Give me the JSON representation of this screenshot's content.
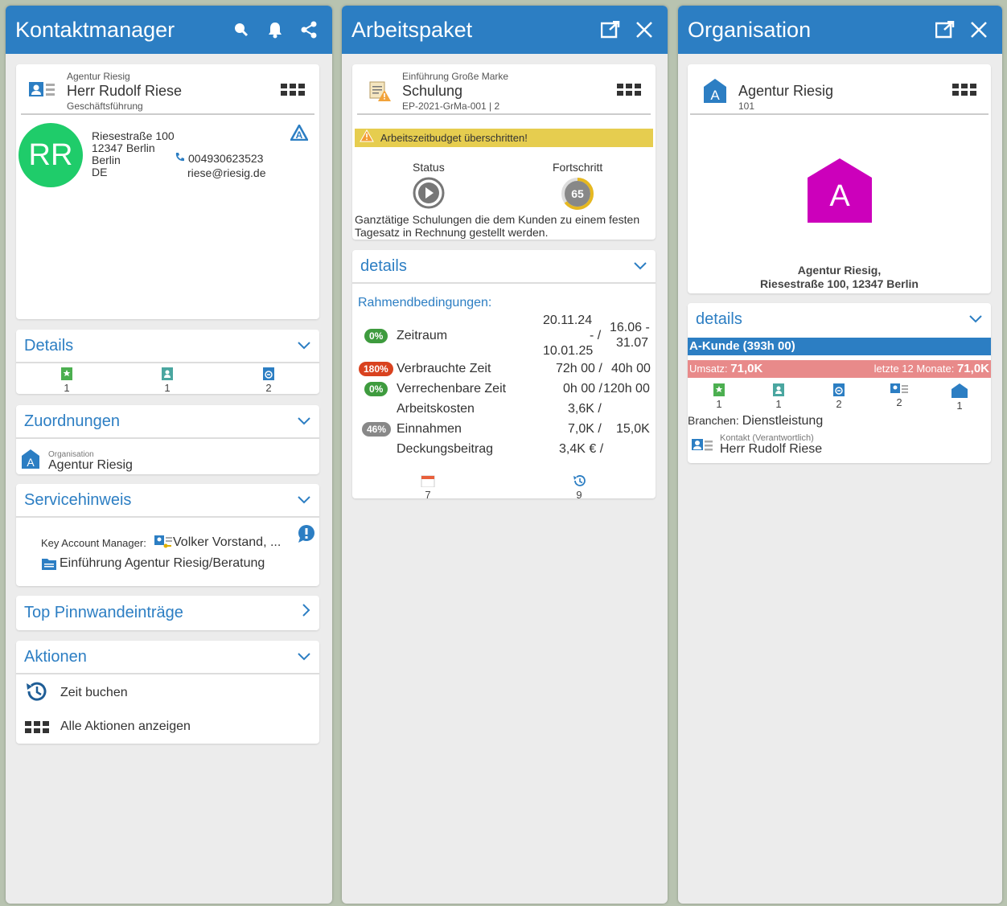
{
  "contact": {
    "title": "Kontaktmanager",
    "company": "Agentur Riesig",
    "name": "Herr Rudolf Riese",
    "role": "Geschäftsführung",
    "initials": "RR",
    "address": [
      "Riesestraße 100",
      "12347 Berlin",
      "Berlin",
      "DE"
    ],
    "phone": "004930623523",
    "email": "riese@riesig.de",
    "details_label": "Details",
    "details_counts": [
      "1",
      "1",
      "2"
    ],
    "zuordnungen_label": "Zuordnungen",
    "org_label": "Organisation",
    "org_name": "Agentur Riesig",
    "service_label": "Servicehinweis",
    "kam_label": "Key Account Manager:",
    "kam_name": "Volker Vorstand, ...",
    "project_link": "Einführung Agentur Riesig/Beratung",
    "pinboard_label": "Top Pinnwandeinträge",
    "actions_label": "Aktionen",
    "action_time": "Zeit buchen",
    "action_all": "Alle Aktionen anzeigen"
  },
  "work": {
    "title": "Arbeitspaket",
    "parent": "Einführung Große Marke",
    "name": "Schulung",
    "code": "EP-2021-GrMa-001 | 2",
    "warning": "Arbeitszeitbudget überschritten!",
    "status_label": "Status",
    "progress_label": "Fortschritt",
    "progress": "65",
    "progress_value": 65,
    "description": "Ganztätige Schulungen die dem Kunden zu einem festen Tagesatz in Rechnung gestellt werden.",
    "details_label": "details",
    "conditions_label": "Rahmendbedingungen:",
    "rows": [
      {
        "badge": "0%",
        "badge_color": "#3e9b3e",
        "label": "Zeitraum",
        "v1a": "20.11.24",
        "v1b": "- /",
        "v1c": "10.01.25",
        "v2a": "16.06 -",
        "v2b": "31.07"
      },
      {
        "badge": "180%",
        "badge_color": "#d9421f",
        "label": "Verbrauchte Zeit",
        "v1": "72h 00 /",
        "v2": "40h 00"
      },
      {
        "badge": "0%",
        "badge_color": "#3e9b3e",
        "label": "Verrechenbare Zeit",
        "v1": "0h 00 /",
        "v2": "120h 00"
      },
      {
        "badge": "",
        "badge_color": "",
        "label": "Arbeitskosten",
        "v1": "3,6K /",
        "v2": ""
      },
      {
        "badge": "46%",
        "badge_color": "#888888",
        "label": "Einnahmen",
        "v1": "7,0K /",
        "v2": "15,0K"
      },
      {
        "badge": "",
        "badge_color": "",
        "label": "Deckungsbeitrag",
        "v1": "3,4K € /",
        "v2": ""
      }
    ],
    "count_calendar": "7",
    "count_history": "9"
  },
  "org": {
    "title": "Organisation",
    "name": "Agentur Riesig",
    "number": "101",
    "logo_letter": "A",
    "address_line1": "Agentur Riesig,",
    "address_line2": "Riesestraße 100, 12347 Berlin",
    "details_label": "details",
    "customer_class": "A-Kunde (393h 00)",
    "revenue_label": "Umsatz:",
    "revenue_value": "71,0K",
    "revenue12_label": "letzte 12 Monate:",
    "revenue12_value": "71,0K",
    "counts": [
      "1",
      "1",
      "2",
      "2",
      "1"
    ],
    "branch_label": "Branchen:",
    "branch_value": "Dienstleistung",
    "contact_label": "Kontakt (Verantwortlich)",
    "contact_name": "Herr Rudolf Riese"
  },
  "colors": {
    "header_blue": "#2c7ec3",
    "avatar_green": "#1fcc6a",
    "warning_yellow": "#e6cd4f",
    "org_logo_magenta": "#cc00bb",
    "revenue_red": "#e88a8a"
  }
}
